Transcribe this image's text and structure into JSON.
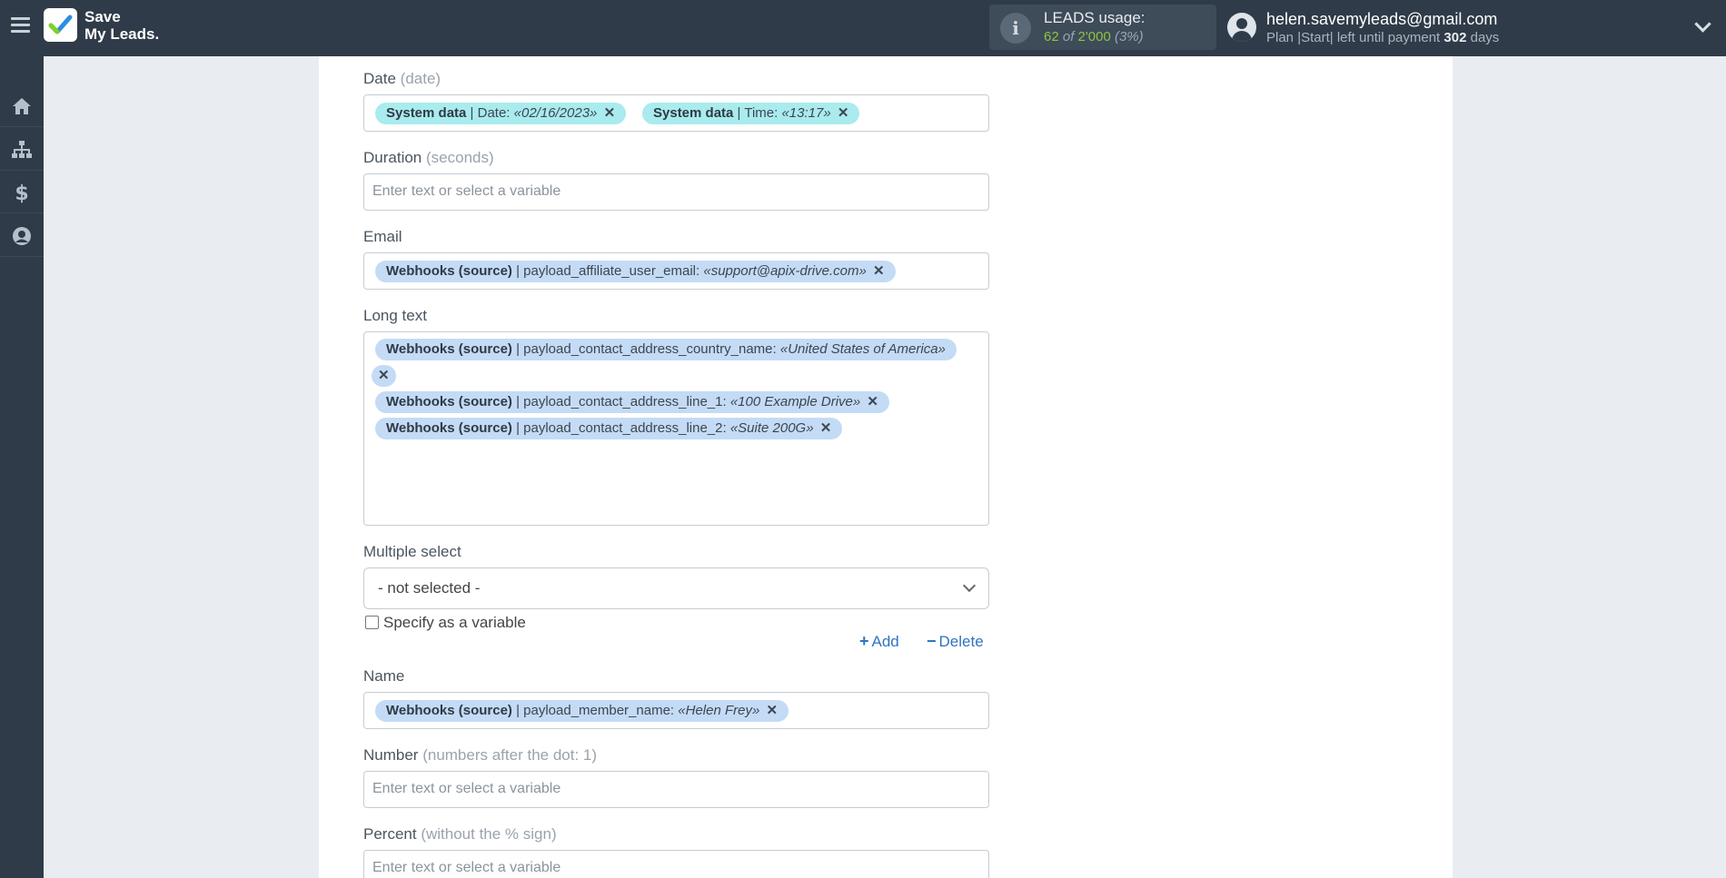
{
  "header": {
    "logo_line1": "Save",
    "logo_line2": "My Leads.",
    "leads_usage": {
      "title": "LEADS usage:",
      "used": "62",
      "of_word": "of",
      "limit": "2'000",
      "percent": "(3%)"
    },
    "user": {
      "email": "helen.savemyleads@gmail.com",
      "plan_text": "Plan |Start| left until payment",
      "days_count": "302",
      "days_word": "days"
    }
  },
  "sidebar": {
    "items": [
      "home-icon",
      "sitemap-icon",
      "dollar-icon",
      "user-circle-icon"
    ]
  },
  "form": {
    "date": {
      "label": "Date",
      "hint": "(date)",
      "chips": [
        {
          "source": "System data",
          "field": "| Date:",
          "value": "«02/16/2023»"
        },
        {
          "source": "System data",
          "field": "| Time:",
          "value": "«13:17»"
        }
      ]
    },
    "duration": {
      "label": "Duration",
      "hint": "(seconds)",
      "placeholder": "Enter text or select a variable"
    },
    "email": {
      "label": "Email",
      "chips": [
        {
          "source": "Webhooks (source)",
          "field": "| payload_affiliate_user_email:",
          "value": "«support@apix-drive.com»"
        }
      ]
    },
    "long_text": {
      "label": "Long text",
      "chips": [
        {
          "source": "Webhooks (source)",
          "field": "| payload_contact_address_country_name:",
          "value": "«United States of America»"
        },
        {
          "source": "Webhooks (source)",
          "field": "| payload_contact_address_line_1:",
          "value": "«100 Example Drive»"
        },
        {
          "source": "Webhooks (source)",
          "field": "| payload_contact_address_line_2:",
          "value": "«Suite 200G»"
        }
      ]
    },
    "multiple_select": {
      "label": "Multiple select",
      "value": "- not selected -",
      "checkbox_label": "Specify as a variable",
      "add_label": "Add",
      "delete_label": "Delete"
    },
    "name": {
      "label": "Name",
      "chips": [
        {
          "source": "Webhooks (source)",
          "field": "| payload_member_name:",
          "value": "«Helen Frey»"
        }
      ]
    },
    "number": {
      "label": "Number",
      "hint": "(numbers after the dot: 1)",
      "placeholder": "Enter text or select a variable"
    },
    "percent": {
      "label": "Percent",
      "hint": "(without the % sign)",
      "placeholder": "Enter text or select a variable"
    }
  },
  "colors": {
    "topbar": "#2f3b48",
    "chip_system": "#a9ebee",
    "chip_webhook": "#c4dbf6",
    "link": "#2f74c0",
    "usage_green": "#8fc33f"
  }
}
